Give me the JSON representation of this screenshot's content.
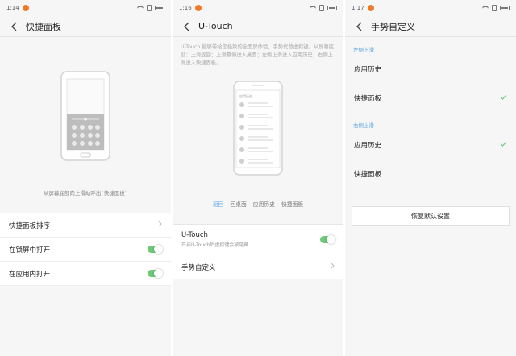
{
  "screens": [
    {
      "time": "1:14",
      "title": "快捷面板",
      "caption": "从屏幕底部向上滑动呼出“快捷面板”",
      "rows": [
        {
          "label": "快捷面板排序"
        },
        {
          "label": "在锁屏中打开",
          "toggle": true
        },
        {
          "label": "在应用内打开",
          "toggle": true
        }
      ]
    },
    {
      "time": "1:16",
      "title": "U-Touch",
      "description": "U-Touch 能够带给您极致的全面屏体验，手势代替虚拟键。从屏幕底部：上滑返回；上滑悬停进入桌面；左侧上滑进入应用历史；右侧上滑进入快捷面板。",
      "illustration_header": "应用历史",
      "tabs": [
        "返回",
        "回桌面",
        "应用历史",
        "快捷面板"
      ],
      "active_tab": "返回",
      "utouch": {
        "label": "U-Touch",
        "sub": "开启U-Touch后虚拟键会被隐藏",
        "toggle": true
      },
      "gesture_row": "手势自定义"
    },
    {
      "time": "1:17",
      "title": "手势自定义",
      "groups": [
        {
          "label": "左侧上滑",
          "options": [
            {
              "label": "应用历史",
              "checked": false
            },
            {
              "label": "快捷面板",
              "checked": true
            }
          ]
        },
        {
          "label": "右侧上滑",
          "options": [
            {
              "label": "应用历史",
              "checked": true
            },
            {
              "label": "快捷面板",
              "checked": false
            }
          ]
        }
      ],
      "reset_button": "恢复默认设置"
    }
  ],
  "colors": {
    "accent": "#5aa3e0",
    "toggle_on": "#6cc978",
    "notification": "#f07a2a"
  }
}
